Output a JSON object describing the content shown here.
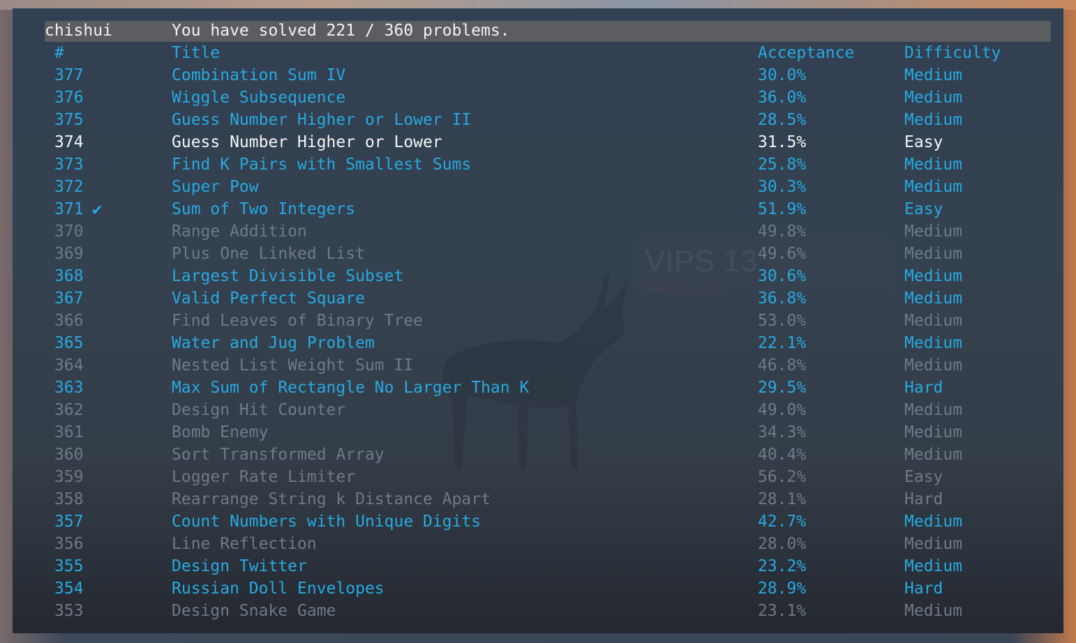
{
  "header": {
    "user": "chishui",
    "summary": "You have solved 221 / 360 problems."
  },
  "columns": {
    "num": "#",
    "title": "Title",
    "acceptance": "Acceptance",
    "difficulty": "Difficulty"
  },
  "background_overlay": {
    "big_text": "VIPS 13",
    "sub_text": "N/A (-1.31%)"
  },
  "colors": {
    "accent": "#27a9e1",
    "locked": "#6f7a86",
    "text": "#f2f2f2",
    "header_bar": "#5c5d61"
  },
  "rows": [
    {
      "num": "377",
      "title": "Combination Sum IV",
      "acceptance": "30.0%",
      "difficulty": "Medium",
      "state": "avail",
      "solved": false
    },
    {
      "num": "376",
      "title": "Wiggle Subsequence",
      "acceptance": "36.0%",
      "difficulty": "Medium",
      "state": "avail",
      "solved": false
    },
    {
      "num": "375",
      "title": "Guess Number Higher or Lower II",
      "acceptance": "28.5%",
      "difficulty": "Medium",
      "state": "avail",
      "solved": false
    },
    {
      "num": "374",
      "title": "Guess Number Higher or Lower",
      "acceptance": "31.5%",
      "difficulty": "Easy",
      "state": "current",
      "solved": false
    },
    {
      "num": "373",
      "title": "Find K Pairs with Smallest Sums",
      "acceptance": "25.8%",
      "difficulty": "Medium",
      "state": "avail",
      "solved": false
    },
    {
      "num": "372",
      "title": "Super Pow",
      "acceptance": "30.3%",
      "difficulty": "Medium",
      "state": "avail",
      "solved": false
    },
    {
      "num": "371",
      "title": "Sum of Two Integers",
      "acceptance": "51.9%",
      "difficulty": "Easy",
      "state": "avail",
      "solved": true,
      "check": "✔"
    },
    {
      "num": "370",
      "title": "Range Addition",
      "acceptance": "49.8%",
      "difficulty": "Medium",
      "state": "locked",
      "solved": false
    },
    {
      "num": "369",
      "title": "Plus One Linked List",
      "acceptance": "49.6%",
      "difficulty": "Medium",
      "state": "locked",
      "solved": false
    },
    {
      "num": "368",
      "title": "Largest Divisible Subset",
      "acceptance": "30.6%",
      "difficulty": "Medium",
      "state": "avail",
      "solved": false
    },
    {
      "num": "367",
      "title": "Valid Perfect Square",
      "acceptance": "36.8%",
      "difficulty": "Medium",
      "state": "avail",
      "solved": false
    },
    {
      "num": "366",
      "title": "Find Leaves of Binary Tree",
      "acceptance": "53.0%",
      "difficulty": "Medium",
      "state": "locked",
      "solved": false
    },
    {
      "num": "365",
      "title": "Water and Jug Problem",
      "acceptance": "22.1%",
      "difficulty": "Medium",
      "state": "avail",
      "solved": false
    },
    {
      "num": "364",
      "title": "Nested List Weight Sum II",
      "acceptance": "46.8%",
      "difficulty": "Medium",
      "state": "locked",
      "solved": false
    },
    {
      "num": "363",
      "title": "Max Sum of Rectangle No Larger Than K",
      "acceptance": "29.5%",
      "difficulty": "Hard",
      "state": "avail",
      "solved": false
    },
    {
      "num": "362",
      "title": "Design Hit Counter",
      "acceptance": "49.0%",
      "difficulty": "Medium",
      "state": "locked",
      "solved": false
    },
    {
      "num": "361",
      "title": "Bomb Enemy",
      "acceptance": "34.3%",
      "difficulty": "Medium",
      "state": "locked",
      "solved": false
    },
    {
      "num": "360",
      "title": "Sort Transformed Array",
      "acceptance": "40.4%",
      "difficulty": "Medium",
      "state": "locked",
      "solved": false
    },
    {
      "num": "359",
      "title": "Logger Rate Limiter",
      "acceptance": "56.2%",
      "difficulty": "Easy",
      "state": "locked",
      "solved": false
    },
    {
      "num": "358",
      "title": "Rearrange String k Distance Apart",
      "acceptance": "28.1%",
      "difficulty": "Hard",
      "state": "locked",
      "solved": false
    },
    {
      "num": "357",
      "title": "Count Numbers with Unique Digits",
      "acceptance": "42.7%",
      "difficulty": "Medium",
      "state": "avail",
      "solved": false
    },
    {
      "num": "356",
      "title": "Line Reflection",
      "acceptance": "28.0%",
      "difficulty": "Medium",
      "state": "locked",
      "solved": false
    },
    {
      "num": "355",
      "title": "Design Twitter",
      "acceptance": "23.2%",
      "difficulty": "Medium",
      "state": "avail",
      "solved": false
    },
    {
      "num": "354",
      "title": "Russian Doll Envelopes",
      "acceptance": "28.9%",
      "difficulty": "Hard",
      "state": "avail",
      "solved": false
    },
    {
      "num": "353",
      "title": "Design Snake Game",
      "acceptance": "23.1%",
      "difficulty": "Medium",
      "state": "locked",
      "solved": false
    }
  ]
}
